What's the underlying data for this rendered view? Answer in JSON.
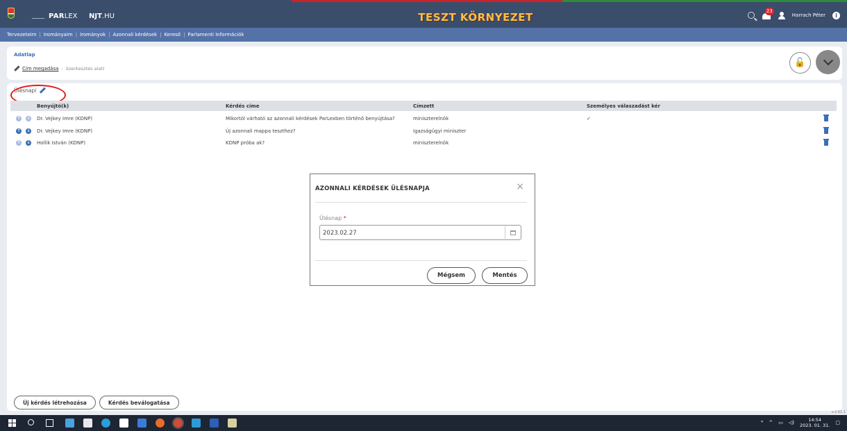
{
  "header": {
    "parlex_prefix": "PAR",
    "parlex_suffix": "LEX",
    "njt_prefix": "NJT",
    "njt_suffix": ".HU",
    "env_title": "TESZT KÖRNYEZET",
    "notification_count": "23",
    "user_name": "Harrach Péter",
    "info_symbol": "i",
    "colors": {
      "bar": "#3a4d6a",
      "env_title": "#f3c246",
      "badge": "#d8262d"
    }
  },
  "nav": {
    "items": [
      "Tervezeteim",
      "Irományaim",
      "Irományok",
      "Azonnali kérdések",
      "Kereső",
      "Parlamenti Információk"
    ],
    "separator": "|"
  },
  "detail": {
    "section_label": "Adatlap",
    "title": "Cím megadása",
    "separator": "-",
    "status": "Szerkesztés alatt",
    "lock_symbol": "🔓"
  },
  "session": {
    "label": "Ülésnapi"
  },
  "table": {
    "columns": [
      "Benyújtó(k)",
      "Kérdés címe",
      "Címzett",
      "Személyes válaszadást kér"
    ],
    "rows": [
      {
        "submitter": "Dr. Vejkey Imre (KDNP)",
        "question": "Mikortól várható az azonnali kérdések ParLexben történő benyújtása?",
        "recipient": "miniszterelnök",
        "personal": "✓"
      },
      {
        "submitter": "Dr. Vejkey Imre (KDNP)",
        "question": "Új azonnali mappa teszthez?",
        "recipient": "igazságügyi miniszter",
        "personal": ""
      },
      {
        "submitter": "Hollik István (KDNP)",
        "question": "KDNP próba ak?",
        "recipient": "miniszterelnök",
        "personal": ""
      }
    ],
    "icon_up": "↑",
    "icon_down": "↓"
  },
  "actions": {
    "new_question": "Új kérdés létrehozása",
    "select_question": "Kérdés beválogatása"
  },
  "version": "v-2.61.1",
  "modal": {
    "title": "AZONNALI KÉRDÉSEK ÜLÉSNAPJA",
    "close_symbol": "×",
    "field_label": "Ülésnap",
    "required_mark": "*",
    "field_value": "2023.02.27",
    "cancel_label": "Mégsem",
    "save_label": "Mentés"
  },
  "taskbar": {
    "time": "14:54",
    "date": "2023. 01. 31."
  }
}
